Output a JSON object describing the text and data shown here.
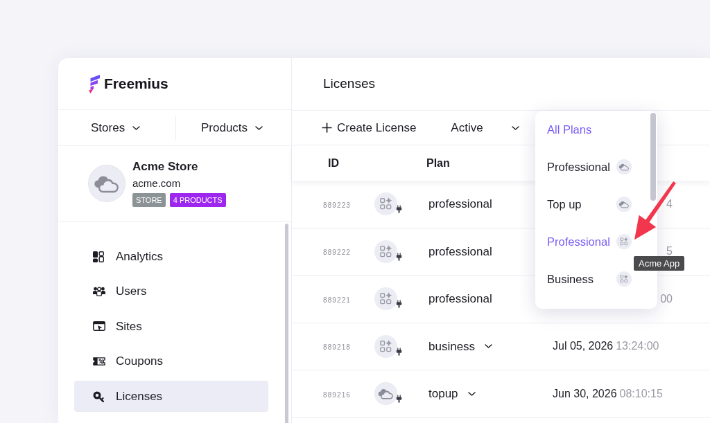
{
  "brand": {
    "name": "Freemius"
  },
  "switchers": [
    {
      "label": "Stores"
    },
    {
      "label": "Products"
    }
  ],
  "store": {
    "name": "Acme Store",
    "domain": "acme.com",
    "badges": [
      {
        "text": "STORE",
        "color": "#8c9397"
      },
      {
        "text": "4 PRODUCTS",
        "color": "#9d27ef"
      }
    ]
  },
  "nav": [
    {
      "label": "Analytics",
      "kind": "analytics",
      "selected": false
    },
    {
      "label": "Users",
      "kind": "users",
      "selected": false
    },
    {
      "label": "Sites",
      "kind": "sites",
      "selected": false
    },
    {
      "label": "Coupons",
      "kind": "coupons",
      "selected": false
    },
    {
      "label": "Licenses",
      "kind": "licenses",
      "selected": true
    }
  ],
  "page": {
    "title": "Licenses"
  },
  "toolbar": {
    "create_label": "Create License",
    "status_filter": "Active"
  },
  "table": {
    "columns": [
      {
        "label": "ID"
      },
      {
        "label": "Plan"
      }
    ],
    "rows": [
      {
        "id": "889223",
        "kind": "app",
        "plan": "professional",
        "has_menu": false,
        "time": "4"
      },
      {
        "id": "889222",
        "kind": "app",
        "plan": "professional",
        "has_menu": false,
        "time": "5"
      },
      {
        "id": "889221",
        "kind": "app",
        "plan": "professional",
        "has_menu": false,
        "time": "00"
      },
      {
        "id": "889218",
        "kind": "app",
        "plan": "business",
        "has_menu": true,
        "date": "Jul 05, 2026",
        "time": "13:24:00"
      },
      {
        "id": "889216",
        "kind": "cloud",
        "plan": "topup",
        "has_menu": true,
        "date": "Jun 30, 2026",
        "time": "08:10:15"
      }
    ]
  },
  "plan_menu": {
    "items": [
      {
        "label": "All Plans",
        "kind": "all",
        "selected": true
      },
      {
        "label": "Professional",
        "kind": "cloud",
        "selected": false
      },
      {
        "label": "Top up",
        "kind": "cloud",
        "selected": false
      },
      {
        "label": "Professional",
        "kind": "app",
        "selected": true
      },
      {
        "label": "Business",
        "kind": "app",
        "selected": false
      }
    ],
    "tooltip": "Acme App"
  },
  "annotation_arrow": true
}
